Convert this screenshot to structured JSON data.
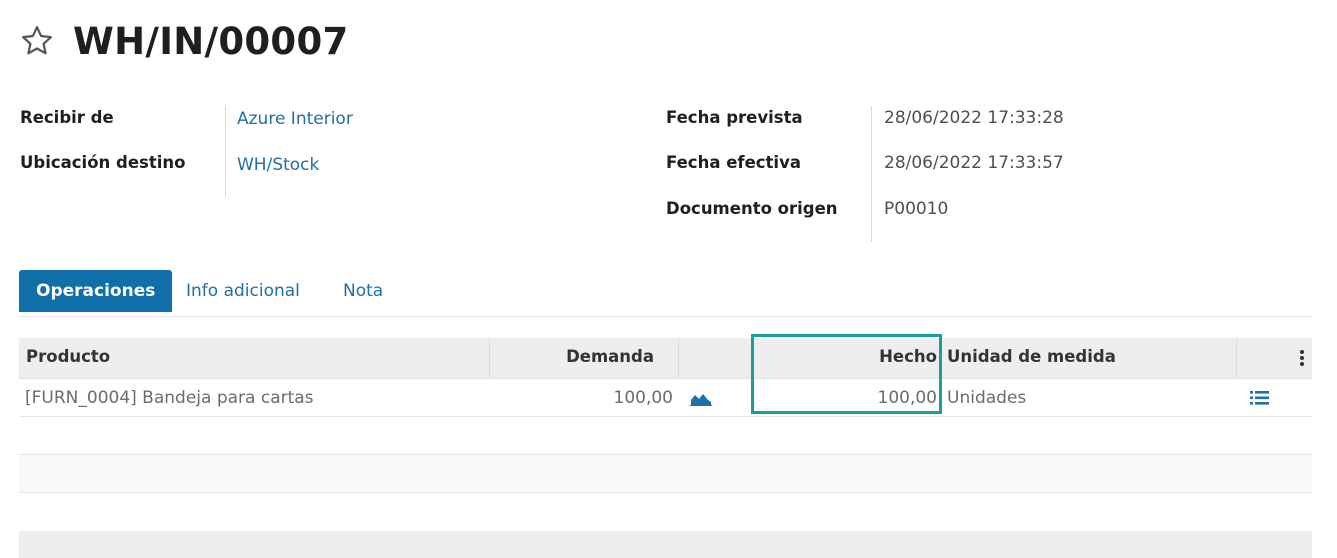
{
  "record": {
    "title": "WH/IN/00007"
  },
  "fields_left": [
    {
      "label": "Recibir de",
      "value": "Azure Interior"
    },
    {
      "label": "Ubicación destino",
      "value": "WH/Stock"
    }
  ],
  "fields_right": [
    {
      "label": "Fecha prevista",
      "value": "28/06/2022 17:33:28"
    },
    {
      "label": "Fecha efectiva",
      "value": "28/06/2022 17:33:57"
    },
    {
      "label": "Documento origen",
      "value": "P00010"
    }
  ],
  "tabs": [
    {
      "label": "Operaciones",
      "active": true
    },
    {
      "label": "Info adicional",
      "active": false
    },
    {
      "label": "Nota",
      "active": false
    }
  ],
  "table": {
    "headers": {
      "product": "Producto",
      "demand": "Demanda",
      "done": "Hecho",
      "uom": "Unidad de medida"
    },
    "rows": [
      {
        "product": "[FURN_0004] Bandeja para cartas",
        "demand": "100,00",
        "done": "100,00",
        "uom": "Unidades",
        "forecast_icon": "area-chart-icon",
        "detail_icon": "list-icon"
      }
    ]
  },
  "icons": {
    "favorite": "star-outline-icon",
    "column_options": "vertical-dots-icon"
  },
  "colors": {
    "accent": "#0f6fa8",
    "link": "#1f6fa8",
    "highlight": "#1a9e96"
  }
}
